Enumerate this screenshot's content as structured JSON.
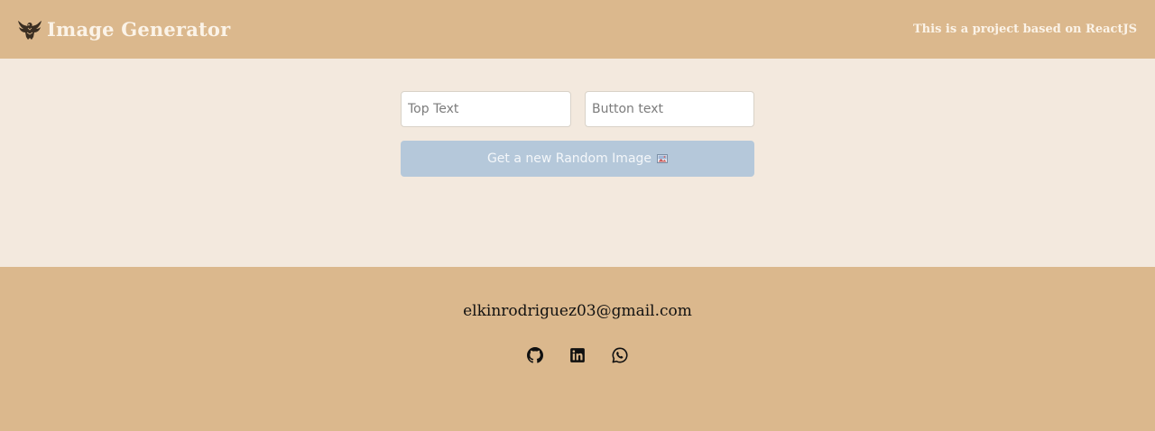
{
  "header": {
    "title": "Image Generator",
    "note": "This is a project based on ReactJS",
    "logo_icon": "eagle-icon"
  },
  "form": {
    "top_text_placeholder": "Top Text",
    "bottom_text_placeholder": "Button text",
    "button_label": "Get a new Random Image",
    "button_icon": "picture-icon"
  },
  "footer": {
    "email": "elkinrodriguez03@gmail.com",
    "social_icons": [
      "github-icon",
      "linkedin-icon",
      "whatsapp-icon"
    ]
  },
  "colors": {
    "header_footer_bg": "#dbb88d",
    "main_bg": "#f3e9de",
    "button_bg": "#b5c8da"
  }
}
